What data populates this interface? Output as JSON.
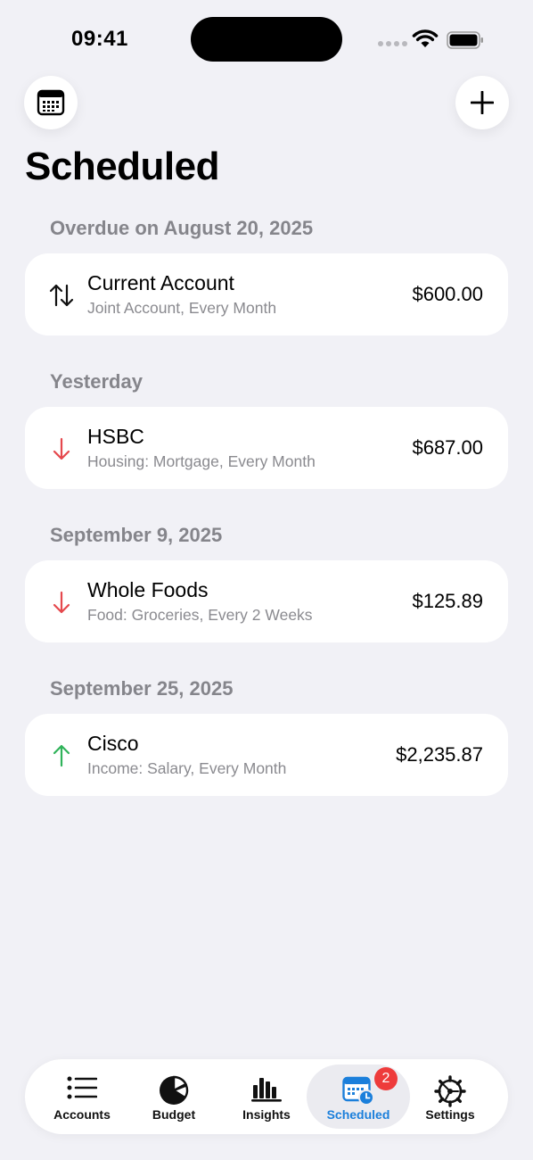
{
  "status_bar": {
    "time": "09:41"
  },
  "header": {
    "title": "Scheduled",
    "left_icon": "calendar-icon",
    "right_icon": "plus-icon"
  },
  "sections": [
    {
      "header": "Overdue on August 20, 2025",
      "item": {
        "name": "Current Account",
        "detail": "Joint Account, Every Month",
        "amount": "$600.00",
        "direction": "transfer",
        "icon": "transfer-arrows-icon"
      }
    },
    {
      "header": "Yesterday",
      "item": {
        "name": "HSBC",
        "detail": "Housing: Mortgage, Every Month",
        "amount": "$687.00",
        "direction": "expense",
        "icon": "arrow-down-icon"
      }
    },
    {
      "header": "September 9, 2025",
      "item": {
        "name": "Whole Foods",
        "detail": "Food: Groceries, Every 2 Weeks",
        "amount": "$125.89",
        "direction": "expense",
        "icon": "arrow-down-icon"
      }
    },
    {
      "header": "September 25, 2025",
      "item": {
        "name": "Cisco",
        "detail": "Income: Salary, Every Month",
        "amount": "$2,235.87",
        "direction": "income",
        "icon": "arrow-up-icon"
      }
    }
  ],
  "tab_bar": {
    "tabs": [
      {
        "label": "Accounts",
        "icon": "list-icon",
        "active": false
      },
      {
        "label": "Budget",
        "icon": "pie-chart-icon",
        "active": false
      },
      {
        "label": "Insights",
        "icon": "bar-chart-icon",
        "active": false
      },
      {
        "label": "Scheduled",
        "icon": "calendar-clock-icon",
        "active": true,
        "badge": "2"
      },
      {
        "label": "Settings",
        "icon": "gear-icon",
        "active": false
      }
    ]
  },
  "colors": {
    "background": "#f1f1f6",
    "accent": "#1b7fdb",
    "expense": "#e5484d",
    "income": "#30b35a",
    "badge": "#ee3b3b"
  }
}
